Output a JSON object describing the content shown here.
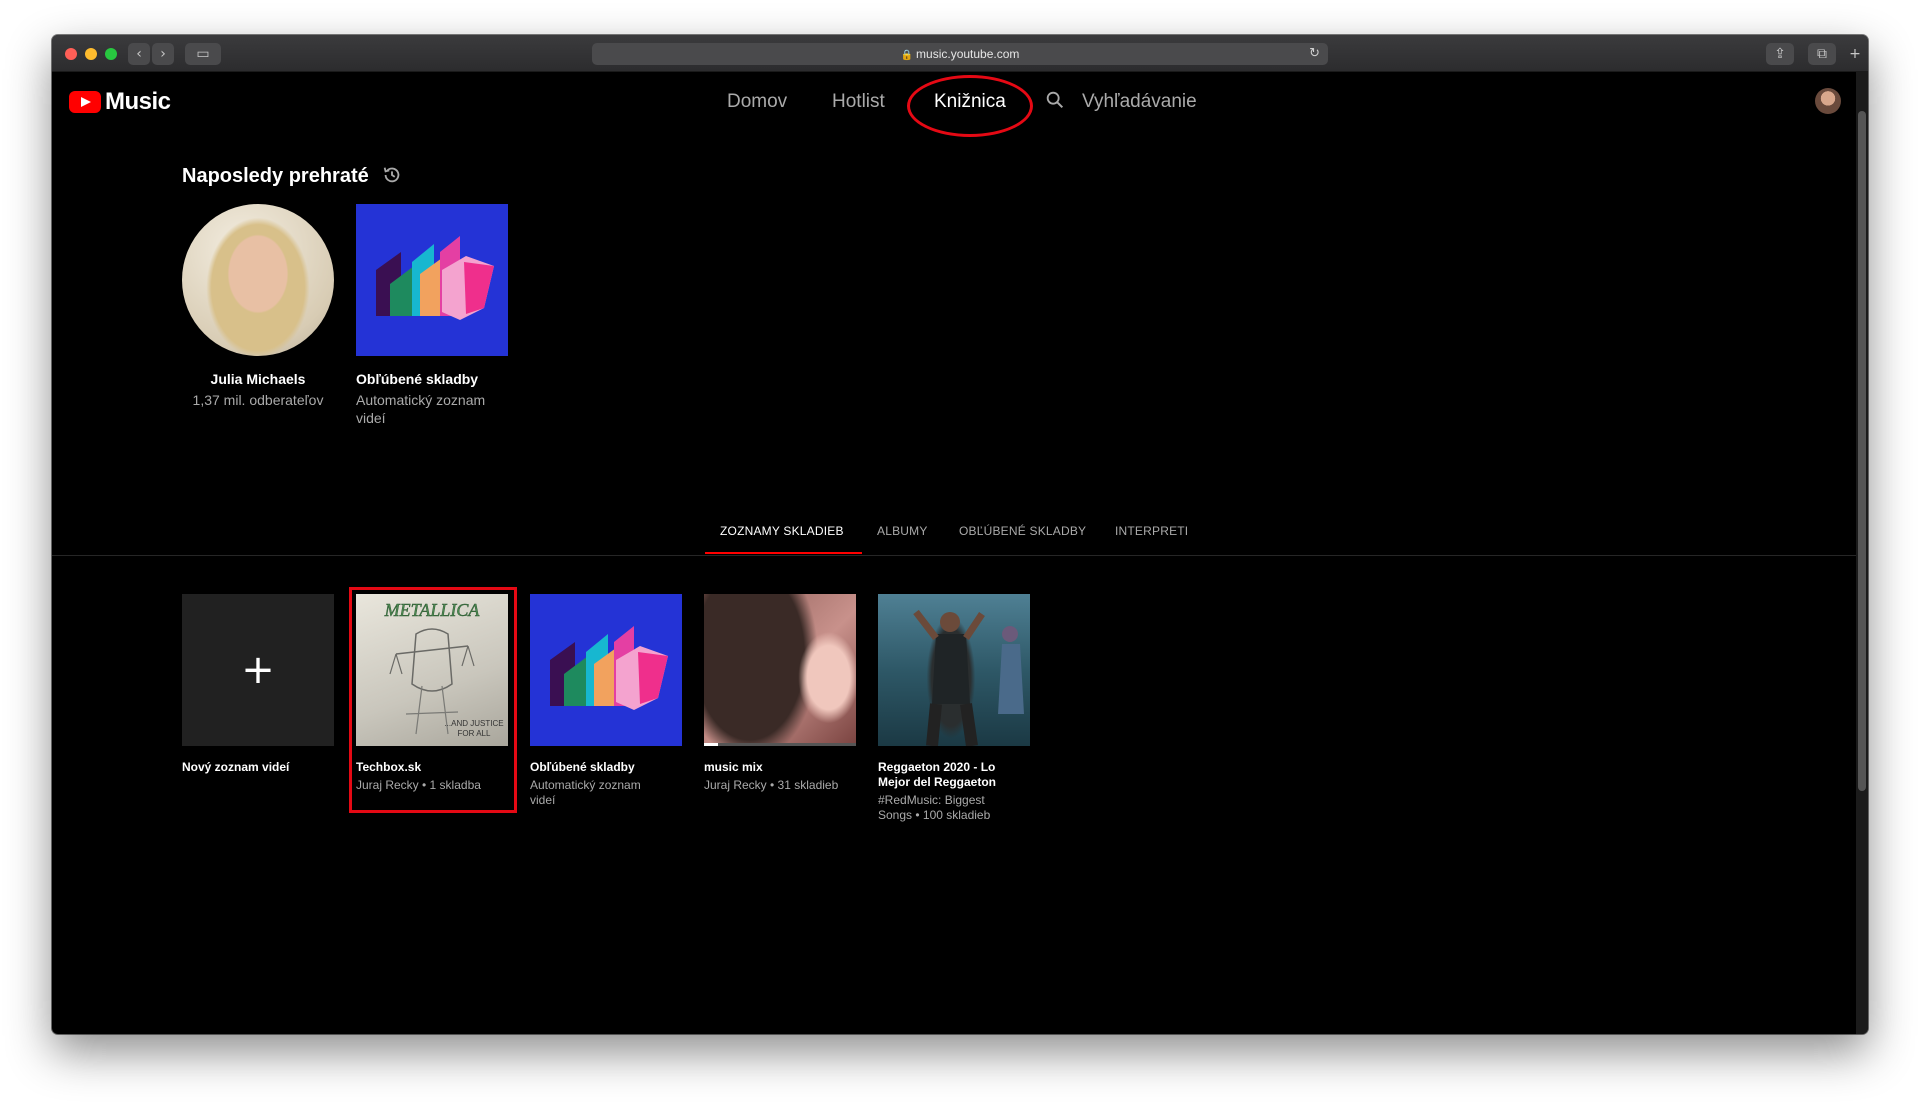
{
  "browser": {
    "url": "music.youtube.com"
  },
  "header": {
    "logo_text": "Music",
    "nav": {
      "home": "Domov",
      "hotlist": "Hotlist",
      "library": "Knižnica",
      "search": "Vyhľadávanie"
    }
  },
  "recent": {
    "title": "Naposledy prehraté",
    "items": [
      {
        "title": "Julia Michaels",
        "subtitle": "1,37 mil. odberateľov"
      },
      {
        "title": "Obľúbené skladby",
        "subtitle_line1": "Automatický zoznam",
        "subtitle_line2": "videí"
      }
    ]
  },
  "tabs": [
    "ZOZNAMY SKLADIEB",
    "ALBUMY",
    "OBĽÚBENÉ SKLADBY",
    "INTERPRETI"
  ],
  "playlists": [
    {
      "title": "Nový zoznam videí"
    },
    {
      "title": "Techbox.sk",
      "subtitle": "Juraj Recky • 1 skladba"
    },
    {
      "title": "Obľúbené skladby",
      "subtitle_line1": "Automatický zoznam",
      "subtitle_line2": "videí"
    },
    {
      "title": "music mix",
      "subtitle": "Juraj Recky • 31 skladieb"
    },
    {
      "title_line1": "Reggaeton 2020 - Lo",
      "title_line2": "Mejor del Reggaeton",
      "subtitle_line1": "#RedMusic: Biggest",
      "subtitle_line2": "Songs • 100 skladieb"
    }
  ],
  "colors": {
    "accent": "#ff0000",
    "annotation": "#e50914",
    "background": "#000000",
    "liked_blue": "#2433d6"
  },
  "icons": [
    "youtube-play-icon",
    "search-icon",
    "history-icon",
    "plus-icon",
    "lock-icon",
    "reload-icon"
  ]
}
